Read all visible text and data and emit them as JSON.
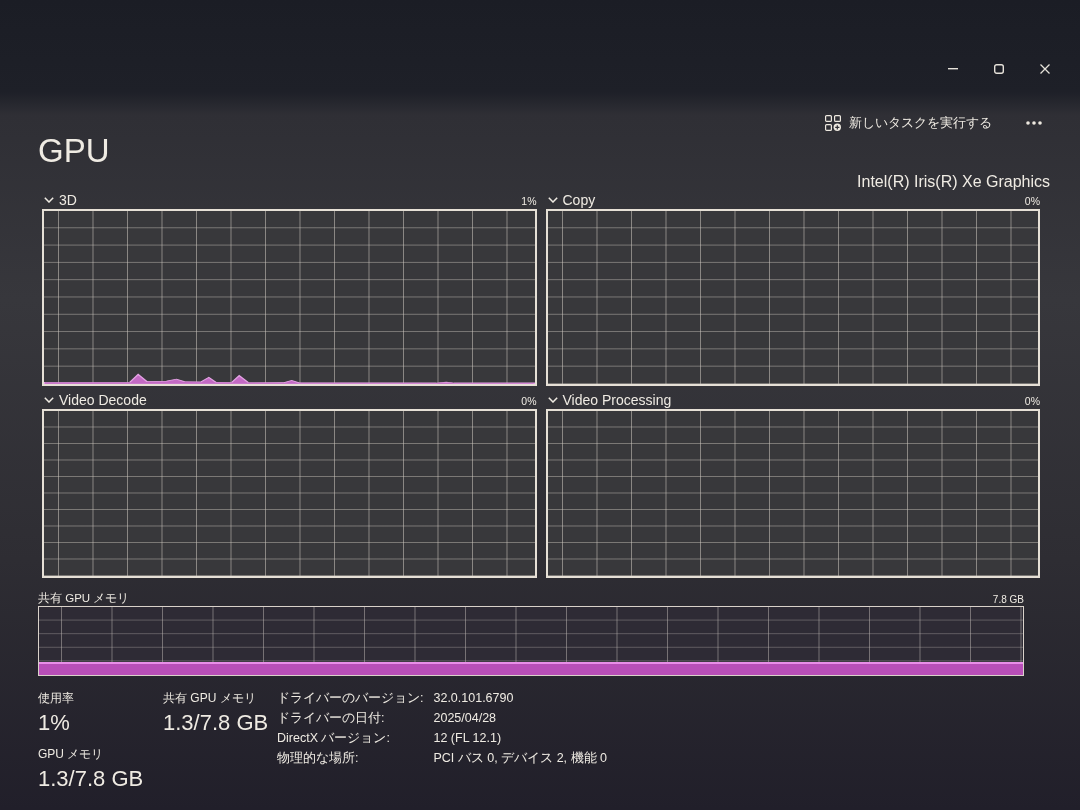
{
  "command_bar": {
    "run_task_button": "新しいタスクを実行する"
  },
  "page": {
    "title": "GPU",
    "adapter_name": "Intel(R) Iris(R) Xe Graphics"
  },
  "engines": [
    {
      "label": "3D",
      "reading": "1%",
      "trace": true
    },
    {
      "label": "Copy",
      "reading": "0%",
      "trace": false
    },
    {
      "label": "Video Decode",
      "reading": "0%",
      "trace": false
    },
    {
      "label": "Video Processing",
      "reading": "0%",
      "trace": false
    }
  ],
  "shared_memory": {
    "label": "共有 GPU メモリ",
    "max": "7.8 GB"
  },
  "stat_columns": [
    [
      {
        "label": "使用率",
        "value": "1%"
      },
      {
        "label": "GPU メモリ",
        "value": "1.3/7.8 GB"
      }
    ],
    [
      {
        "label": "共有 GPU メモリ",
        "value": "1.3/7.8 GB"
      }
    ]
  ],
  "details": [
    {
      "label": "ドライバーのバージョン:",
      "value": "32.0.101.6790"
    },
    {
      "label": "ドライバーの日付:",
      "value": "2025/04/28"
    },
    {
      "label": "DirectX バージョン:",
      "value": "12 (FL 12.1)"
    },
    {
      "label": "物理的な場所:",
      "value": "PCI バス 0, デバイス 2, 機能 0"
    }
  ]
}
